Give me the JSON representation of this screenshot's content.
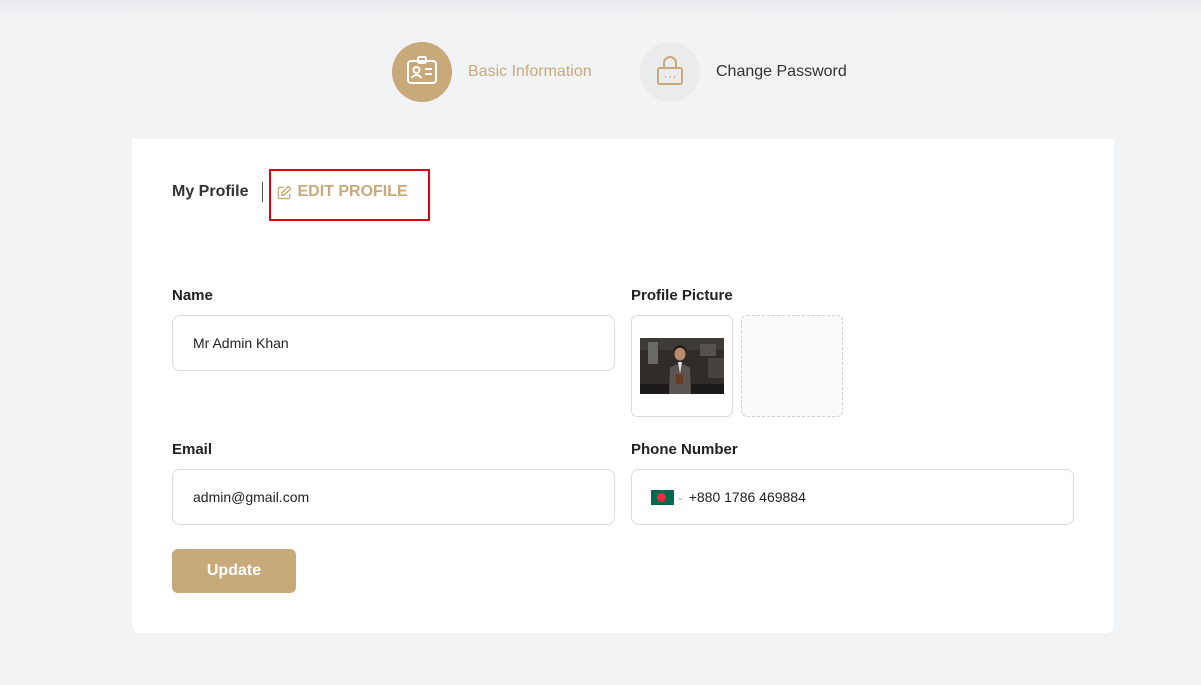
{
  "steps": {
    "basic_info_label": "Basic Information",
    "change_password_label": "Change Password",
    "active_color": "#c8a97a"
  },
  "profile": {
    "tab_title": "My Profile",
    "edit_label": "EDIT PROFILE"
  },
  "form": {
    "name_label": "Name",
    "name_value": "Mr Admin Khan",
    "email_label": "Email",
    "email_value": "admin@gmail.com",
    "picture_label": "Profile Picture",
    "phone_label": "Phone Number",
    "phone_country": "Bangladesh",
    "phone_value": "+880 1786 469884",
    "update_label": "Update"
  },
  "icons": {
    "basic_info": "id-card-icon",
    "change_password": "lock-icon",
    "edit": "edit-icon"
  }
}
